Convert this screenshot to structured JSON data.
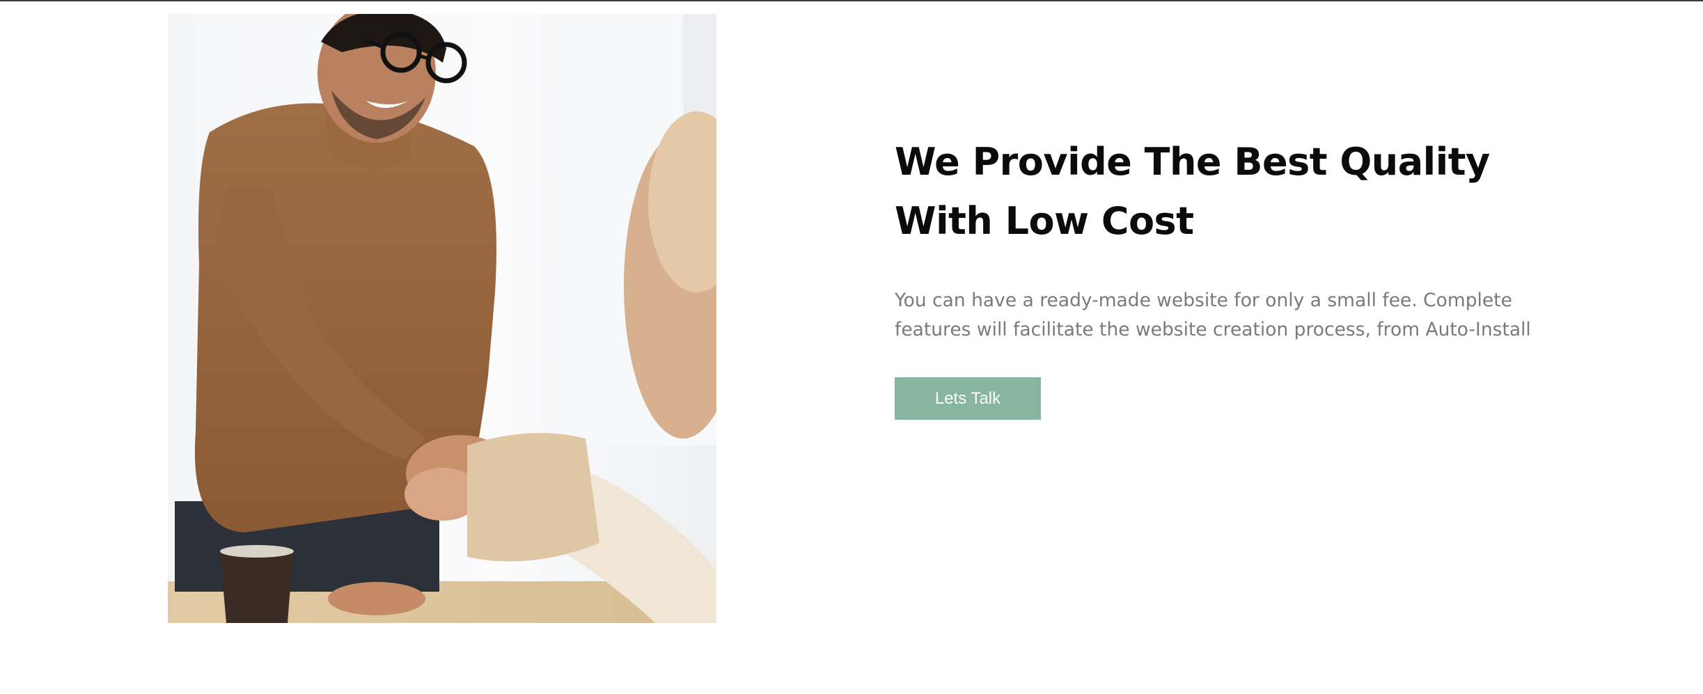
{
  "hero": {
    "image_alt": "Two people shaking hands across a table",
    "headline": "We Provide The Best Quality With Low Cost",
    "description": "You can have a ready-made website for only a small fee. Complete features will facilitate the website creation process, from Auto-Install",
    "cta_label": "Lets Talk"
  },
  "colors": {
    "cta_background": "#88b5a0",
    "headline": "#0b0b0b",
    "body_text": "#7a7a7a",
    "top_rule": "#3a3a3a"
  }
}
